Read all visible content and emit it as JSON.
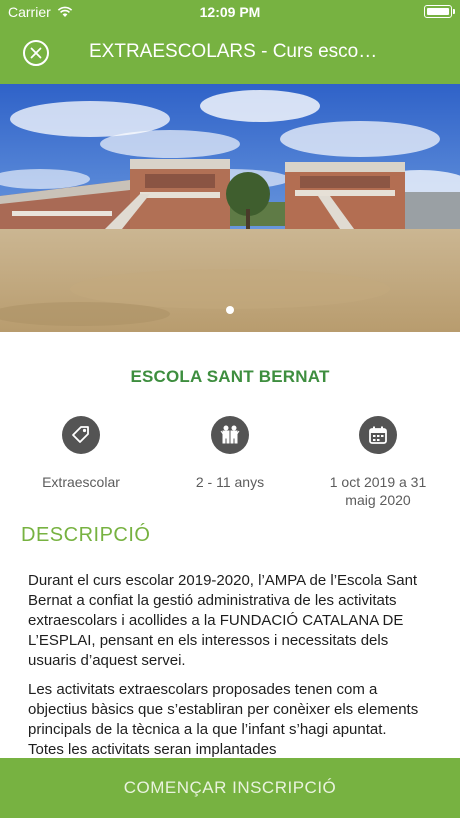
{
  "status_bar": {
    "carrier": "Carrier",
    "time": "12:09 PM"
  },
  "nav": {
    "title": "EXTRAESCOLARS - Curs escola…",
    "close_icon": "close-icon"
  },
  "gallery": {
    "current_page": 1,
    "total_pages": 1,
    "image": "school courtyard with two brick buildings and blue sky"
  },
  "school": {
    "name": "ESCOLA SANT BERNAT"
  },
  "features": [
    {
      "icon": "tag-icon",
      "label": "Extraescolar"
    },
    {
      "icon": "children-icon",
      "label": "2 - 11 anys"
    },
    {
      "icon": "calendar-icon",
      "label": "1 oct 2019 a 31 maig 2020"
    }
  ],
  "description": {
    "title": "DESCRIPCIÓ",
    "paragraphs": [
      "Durant el curs escolar 2019-2020, l’AMPA de l’Escola Sant Bernat a confiat la gestió administrativa de les activitats extraescolars i acollides a la FUNDACIÓ CATALANA DE L’ESPLAI, pensant en els interessos i necessitats dels usuaris d’aquest servei.",
      "Les activitats extraescolars proposades tenen com a objectius bàsics que s’establiran per conèixer els elements principals de la tècnica a la que l’infant s’hagi apuntat. Totes les activitats seran implantades"
    ]
  },
  "cta": {
    "label": "COMENÇAR INSCRIPCIÓ"
  },
  "colors": {
    "brand_green": "#77b241",
    "title_green": "#3e8e3f",
    "icon_gray": "#545454"
  }
}
